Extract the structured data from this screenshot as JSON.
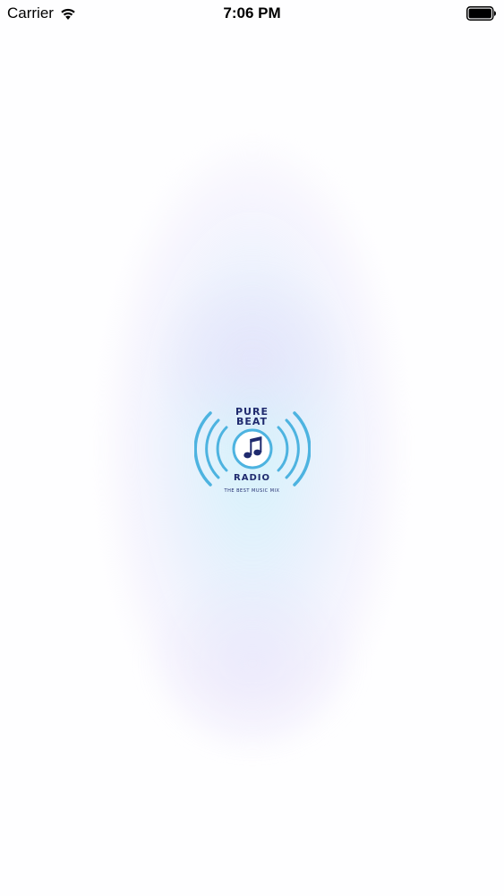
{
  "status_bar": {
    "carrier": "Carrier",
    "time": "7:06 PM",
    "wifi_icon": "wifi-icon",
    "battery_icon": "battery-icon"
  },
  "splash": {
    "logo": {
      "line1": "PURE",
      "line2": "BEAT",
      "line3": "RADIO",
      "tagline": "THE BEST MUSIC MIX",
      "icon": "music-note-icon",
      "colors": {
        "arc": "#4db3e0",
        "text": "#1f2a6e",
        "note": "#1f2a6e"
      }
    },
    "background_glow_colors": [
      "#cdf0fa",
      "#e1ebfc",
      "#f0ecfc"
    ]
  }
}
